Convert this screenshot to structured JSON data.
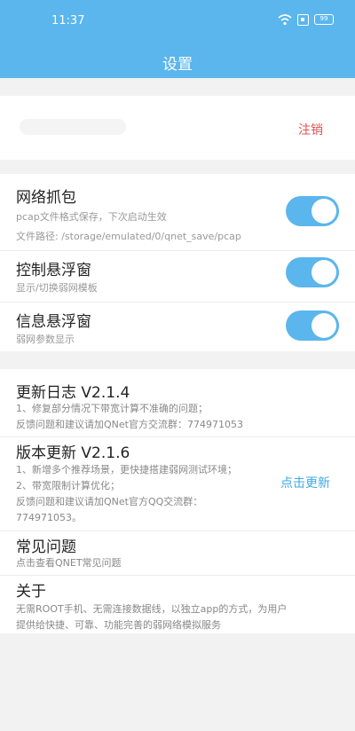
{
  "status": {
    "time": "11:37",
    "battery": "99"
  },
  "title": "设置",
  "account": {
    "logout_label": "注销"
  },
  "settings": {
    "capture": {
      "title": "网络抓包",
      "desc": "pcap文件格式保存，下次启动生效",
      "path": "文件路径: /storage/emulated/0/qnet_save/pcap",
      "enabled": true
    },
    "control_float": {
      "title": "控制悬浮窗",
      "desc": "显示/切换弱网模板",
      "enabled": true
    },
    "info_float": {
      "title": "信息悬浮窗",
      "desc": "弱网参数显示",
      "enabled": true
    }
  },
  "changelog": {
    "title": "更新日志 V2.1.4",
    "lines": [
      "1、修复部分情况下带宽计算不准确的问题；",
      "反馈问题和建议请加QNet官方交流群：774971053"
    ]
  },
  "version_update": {
    "title": "版本更新 V2.1.6",
    "lines": [
      "1、新增多个推荐场景，更快捷搭建弱网测试环境；",
      "2、带宽限制计算优化；",
      "反馈问题和建议请加QNet官方QQ交流群：",
      "774971053。"
    ],
    "action_label": "点击更新"
  },
  "faq": {
    "title": "常见问题",
    "desc": "点击查看QNET常见问题"
  },
  "about": {
    "title": "关于",
    "lines": [
      "无需ROOT手机、无需连接数据线，以独立app的方式，为用户",
      "提供给快捷、可靠、功能完善的弱网络模拟服务"
    ]
  },
  "colors": {
    "accent": "#5ab6ec",
    "logout": "#e0534e",
    "link": "#3fa8e6"
  }
}
